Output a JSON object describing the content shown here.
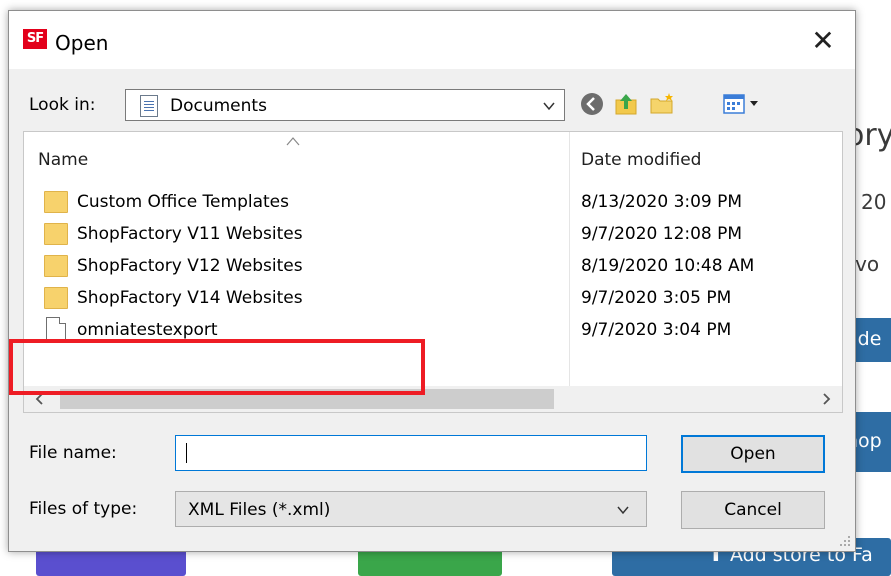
{
  "background": {
    "fragments": [
      "ory",
      "d 20",
      ": vo",
      "ade",
      "hop"
    ],
    "bottom_button": "⬆ Add store to Fa",
    "colors": {
      "blue": "#2e6da4",
      "purple": "#5a4fcf",
      "green": "#3aa64a"
    }
  },
  "dialog": {
    "title": "Open",
    "logo_text": "SF",
    "close_symbol": "✕",
    "look_in": {
      "label": "Look in:",
      "value": "Documents"
    },
    "toolbar_icons": [
      "back-icon",
      "up-folder-icon",
      "new-folder-icon",
      "view-menu-icon"
    ],
    "columns": {
      "name": "Name",
      "date": "Date modified"
    },
    "files": [
      {
        "name": "Custom Office Templates",
        "date": "8/13/2020 3:09 PM",
        "type": "folder"
      },
      {
        "name": "ShopFactory V11 Websites",
        "date": "9/7/2020 12:08 PM",
        "type": "folder"
      },
      {
        "name": "ShopFactory V12 Websites",
        "date": "8/19/2020 10:48 AM",
        "type": "folder"
      },
      {
        "name": "ShopFactory V14 Websites",
        "date": "9/7/2020 3:05 PM",
        "type": "folder"
      },
      {
        "name": "omniatestexport",
        "date": "9/7/2020 3:04 PM",
        "type": "file"
      }
    ],
    "file_name": {
      "label": "File name:",
      "value": ""
    },
    "file_type": {
      "label": "Files of type:",
      "value": "XML Files (*.xml)"
    },
    "buttons": {
      "open": "Open",
      "cancel": "Cancel"
    },
    "colors": {
      "highlight": "#ee1c24",
      "accent": "#0078d7",
      "logo": "#e3001b"
    }
  }
}
